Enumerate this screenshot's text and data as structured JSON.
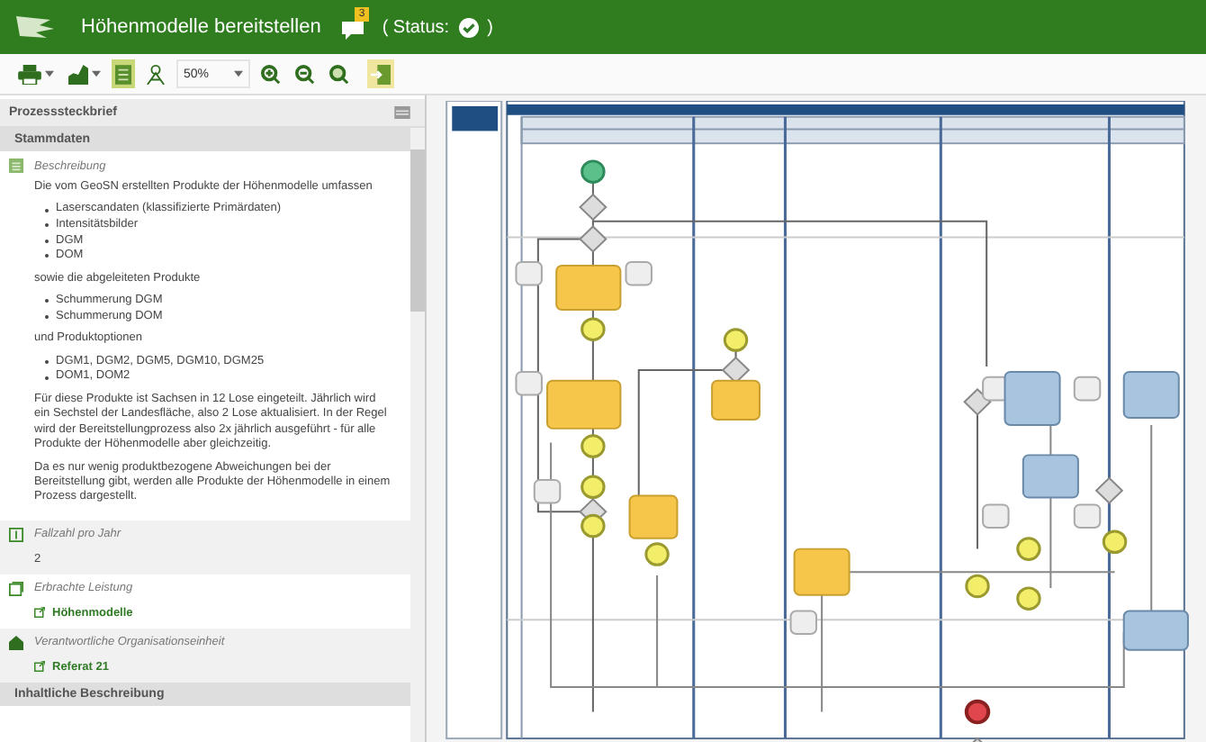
{
  "header": {
    "title": "Höhenmodelle bereitstellen",
    "badge": "3",
    "status_label": "( Status:",
    "status_done": true,
    "status_close": ")"
  },
  "toolbar": {
    "view_toggles": [
      {
        "selected": true
      },
      {
        "selected": false
      }
    ],
    "zoom": "50%"
  },
  "panel": {
    "title": "Prozesssteckbrief",
    "group": "Stammdaten",
    "sections": [
      {
        "kind": "description",
        "label": "Beschreibung",
        "blocks": [
          {
            "text": "Die vom GeoSN erstellten Produkte der Höhenmodelle umfassen"
          },
          {
            "items": [
              "Laserscandaten (klassifizierte Primärdaten)",
              "Intensitätsbilder",
              "DGM",
              "DOM"
            ]
          },
          {
            "text": "sowie die abgeleiteten Produkte"
          },
          {
            "items": [
              "Schummerung DGM",
              "Schummerung DOM"
            ]
          },
          {
            "text": "und Produktoptionen"
          },
          {
            "items": [
              "DGM1, DGM2, DGM5, DGM10, DGM25",
              "DOM1, DOM2"
            ]
          },
          {
            "text": "Für diese Produkte ist Sachsen in 12 Lose eingeteilt. Jährlich wird ein Sechstel der Landesfläche, also 2 Lose aktualisiert. In der Regel wird der Bereitstellungprozess also 2x jährlich ausgeführt - für alle Produkte der Höhenmodelle aber gleichzeitig."
          },
          {
            "text": "Da es nur wenig produktbezogene Abweichungen bei der Bereitstellung gibt, werden alle Produkte der Höhenmodelle in einem Prozess dargestellt."
          }
        ]
      },
      {
        "kind": "count",
        "label": "Fallzahl pro Jahr",
        "value": "2"
      },
      {
        "kind": "service",
        "label": "Erbrachte Leistung",
        "link": "Höhenmodelle"
      },
      {
        "kind": "org",
        "label": "Verantwortliche Organisationseinheit",
        "link": "Referat 21"
      }
    ],
    "next_group": "Inhaltliche Beschreibung"
  }
}
